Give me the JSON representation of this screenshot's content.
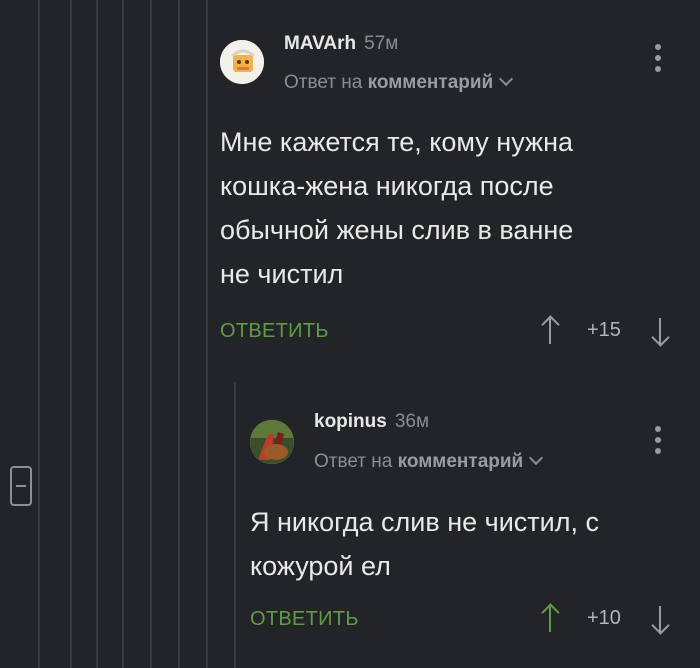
{
  "comments": [
    {
      "username": "MAVArh",
      "time": "57м",
      "reply_prefix": "Ответ на",
      "reply_target": "комментарий",
      "text_lines": [
        "Мне кажется те, кому нужна",
        "кошка-жена никогда после",
        "обычной жены слив в ванне",
        "не чистил"
      ],
      "reply_label": "ОТВЕТИТЬ",
      "score": "+15",
      "upvoted": false
    },
    {
      "username": "kopinus",
      "time": "36м",
      "reply_prefix": "Ответ на",
      "reply_target": "комментарий",
      "text_lines": [
        "Я никогда слив не чистил, с",
        "кожурой ел"
      ],
      "reply_label": "ОТВЕТИТЬ",
      "score": "+10",
      "upvoted": true
    }
  ],
  "colors": {
    "background": "#222428",
    "accent_green": "#5f9b48",
    "muted": "#8b8d92"
  },
  "icons": [
    "collapse-thread-icon",
    "kebab-menu-icon",
    "upvote-arrow-icon",
    "downvote-arrow-icon",
    "chevron-down-icon"
  ]
}
